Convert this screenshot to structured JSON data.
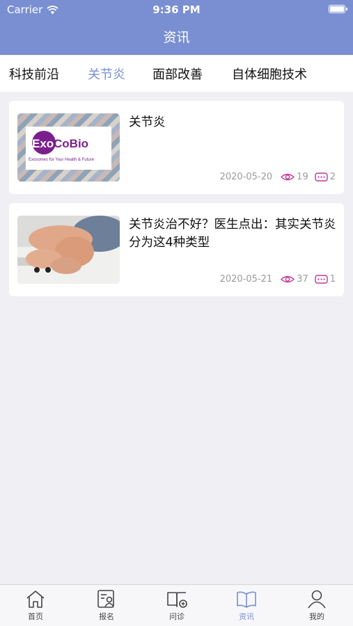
{
  "status_bar": {
    "carrier": "Carrier",
    "time": "9:36 PM"
  },
  "nav": {
    "title": "资讯"
  },
  "tabs": [
    {
      "label": "科技前沿",
      "active": false
    },
    {
      "label": "关节炎",
      "active": true
    },
    {
      "label": "面部改善",
      "active": false
    },
    {
      "label": "自体细胞技术",
      "active": false
    }
  ],
  "articles": [
    {
      "title": "关节炎",
      "date": "2020-05-20",
      "views": "19",
      "comments": "2",
      "thumb_logo_text": "ExoCoBio",
      "thumb_tagline": "Exosomes for Your Health & Future"
    },
    {
      "title": "关节炎治不好？医生点出：其实关节炎分为这4种类型",
      "date": "2020-05-21",
      "views": "37",
      "comments": "1"
    }
  ],
  "tabbar": [
    {
      "label": "首页",
      "icon": "home-icon",
      "active": false
    },
    {
      "label": "报名",
      "icon": "signup-icon",
      "active": false
    },
    {
      "label": "问诊",
      "icon": "consult-icon",
      "active": false
    },
    {
      "label": "资讯",
      "icon": "news-book-icon",
      "active": true
    },
    {
      "label": "我的",
      "icon": "profile-icon",
      "active": false
    }
  ],
  "colors": {
    "accent": "#7a8fd2",
    "meta_icon": "#c2359a",
    "background": "#efeff4"
  }
}
